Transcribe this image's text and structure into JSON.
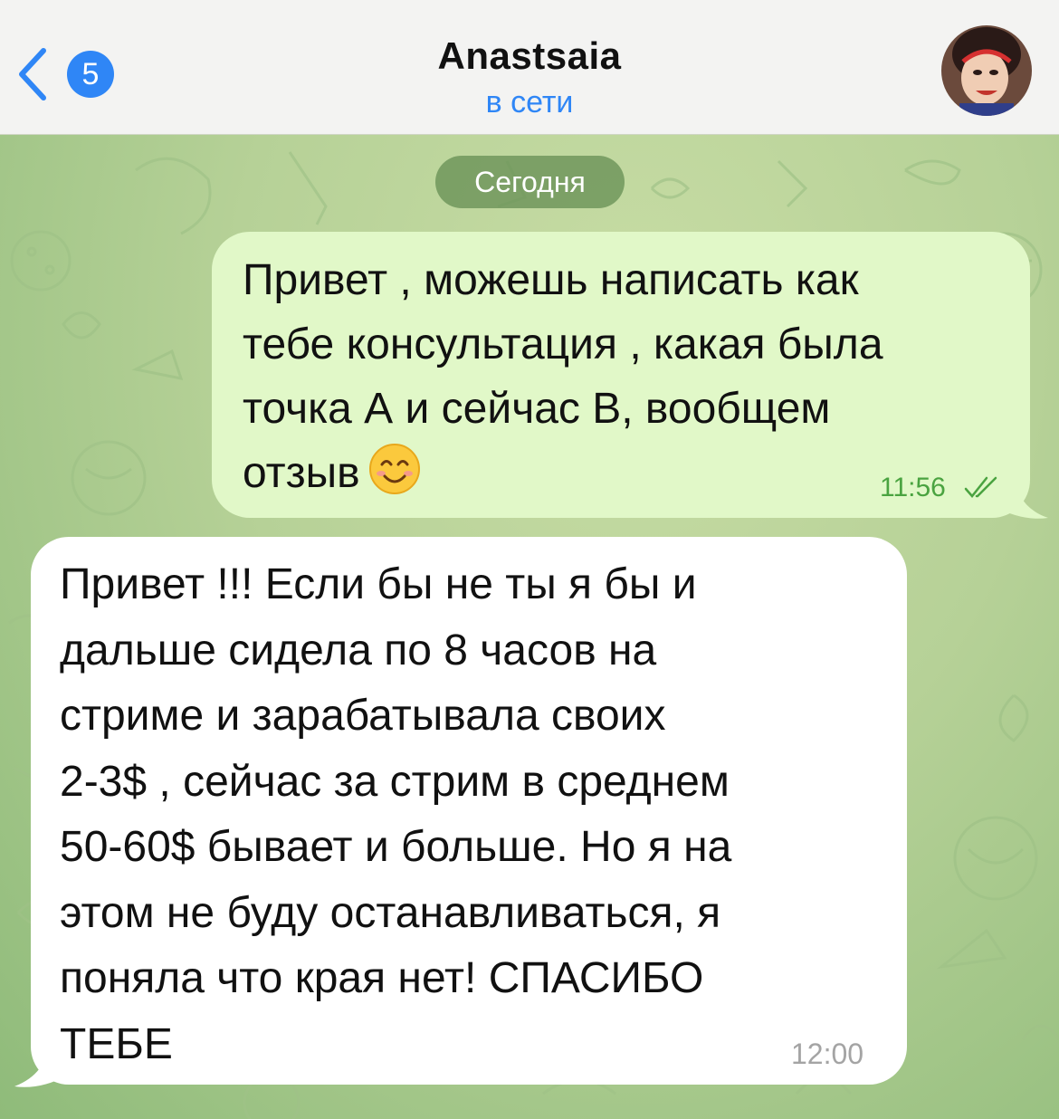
{
  "header": {
    "back_badge": "5",
    "title": "Anastsaia",
    "status": "в сети"
  },
  "date_separator": "Сегодня",
  "messages": [
    {
      "direction": "outgoing",
      "lines": [
        "Привет , можешь написать как",
        "тебе консультация , какая была",
        "точка А и сейчас В, вообщем",
        "отзыв"
      ],
      "emoji": "smiling-face-emoji",
      "time": "11:56",
      "read_status": "read"
    },
    {
      "direction": "incoming",
      "lines": [
        "Привет !!! Если бы не ты я бы и",
        "дальше сидела по 8 часов на",
        "стриме и зарабатывала своих",
        "2-3$ , сейчас за стрим в среднем",
        "50-60$ бывает и больше. Но я на",
        "этом не буду останавливаться, я",
        "поняла что края нет! СПАСИБО",
        "ТЕБЕ"
      ],
      "time": "12:00"
    }
  ],
  "colors": {
    "accent": "#2f86f6",
    "outgoing_bubble": "#e1f8c8",
    "incoming_bubble": "#ffffff",
    "read_check": "#4aa340"
  }
}
